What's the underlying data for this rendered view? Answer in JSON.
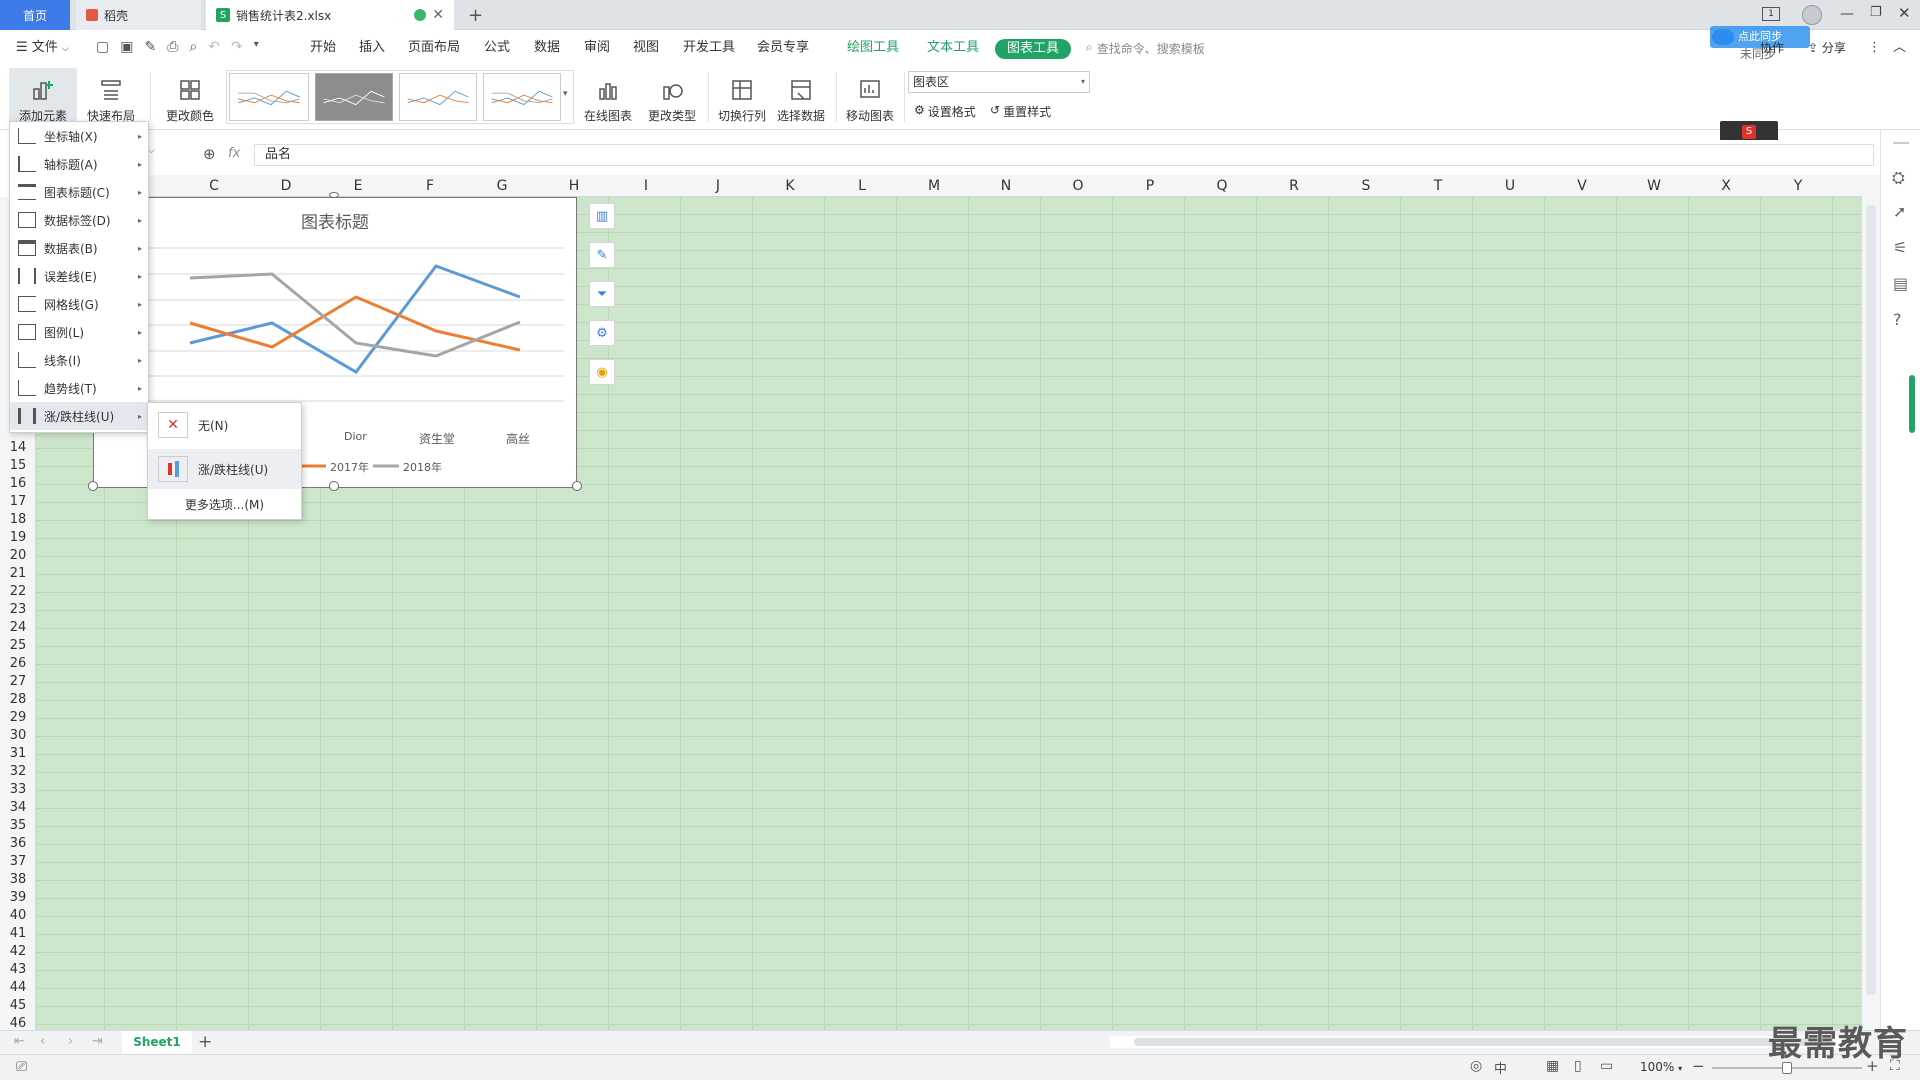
{
  "titlebar": {
    "home_tab": "首页",
    "daoke_tab": "稻壳",
    "file_tab": "销售统计表2.xlsx",
    "new_tab": "+",
    "window_badge": "1"
  },
  "menubar": {
    "file": "文件",
    "items": [
      "开始",
      "插入",
      "页面布局",
      "公式",
      "数据",
      "审阅",
      "视图",
      "开发工具",
      "会员专享"
    ],
    "drawing_tools": "绘图工具",
    "text_tools": "文本工具",
    "chart_tools": "图表工具",
    "search_placeholder": "查找命令、搜索模板",
    "sync_label": "未同步",
    "collab_label": "协作",
    "share_label": "分享",
    "tooltip": "点此同步"
  },
  "ribbon": {
    "add_element": "添加元素",
    "quick_layout": "快速布局",
    "change_color": "更改颜色",
    "online_chart": "在线图表",
    "change_type": "更改类型",
    "switch_row_col": "切换行列",
    "select_data": "选择数据",
    "move_chart": "移动图表",
    "chart_area_select": "图表区",
    "set_format": "设置格式",
    "reset_style": "重置样式"
  },
  "formula_bar": {
    "fx": "fx",
    "content": "品名"
  },
  "columns": [
    "C",
    "D",
    "E",
    "F",
    "G",
    "H",
    "I",
    "J",
    "K",
    "L",
    "M",
    "N",
    "O",
    "P",
    "Q",
    "R",
    "S",
    "T",
    "U",
    "V",
    "W",
    "X",
    "Y"
  ],
  "rows": [
    "14",
    "15",
    "16",
    "17",
    "18",
    "19",
    "20",
    "21",
    "22",
    "23",
    "24",
    "25",
    "26",
    "27",
    "28",
    "29",
    "30",
    "31",
    "32",
    "33",
    "34",
    "35",
    "36",
    "37",
    "38",
    "39",
    "40",
    "41",
    "42",
    "43",
    "44",
    "45",
    "46"
  ],
  "chart": {
    "title": "图表标题",
    "visible_categories": [
      "Dior",
      "资生堂",
      "高丝"
    ],
    "legend": [
      "2017年",
      "2018年"
    ],
    "colors": {
      "series1": "#5b9bd5",
      "series2": "#ed7d31",
      "series3": "#a5a5a5"
    }
  },
  "add_element_menu": [
    {
      "label": "坐标轴(X)",
      "icon": "axis-icon"
    },
    {
      "label": "轴标题(A)",
      "icon": "axis-title-icon"
    },
    {
      "label": "图表标题(C)",
      "icon": "chart-title-icon"
    },
    {
      "label": "数据标签(D)",
      "icon": "data-label-icon"
    },
    {
      "label": "数据表(B)",
      "icon": "data-table-icon"
    },
    {
      "label": "误差线(E)",
      "icon": "error-bar-icon"
    },
    {
      "label": "网格线(G)",
      "icon": "gridline-icon"
    },
    {
      "label": "图例(L)",
      "icon": "legend-icon"
    },
    {
      "label": "线条(I)",
      "icon": "lines-icon"
    },
    {
      "label": "趋势线(T)",
      "icon": "trendline-icon"
    },
    {
      "label": "涨/跌柱线(U)",
      "icon": "updown-bars-icon"
    }
  ],
  "updown_submenu": {
    "none": "无(N)",
    "updown": "涨/跌柱线(U)",
    "more": "更多选项...(M)"
  },
  "sheetbar": {
    "sheet1": "Sheet1"
  },
  "statusbar": {
    "zoom": "100%",
    "zoom_level": 0.5
  },
  "watermark": "最需教育"
}
